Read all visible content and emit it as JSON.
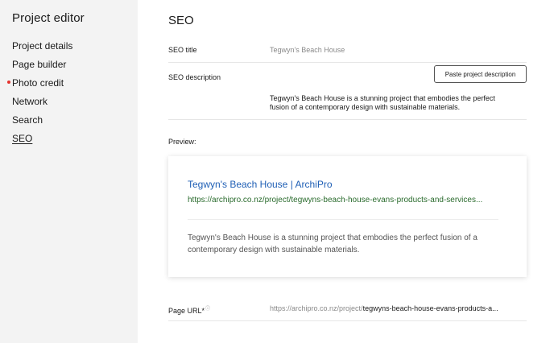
{
  "sidebar": {
    "title": "Project editor",
    "items": [
      {
        "label": "Project details"
      },
      {
        "label": "Page builder"
      },
      {
        "label": "Photo credit"
      },
      {
        "label": "Network"
      },
      {
        "label": "Search"
      },
      {
        "label": "SEO"
      }
    ]
  },
  "main": {
    "title": "SEO",
    "seo_title": {
      "label": "SEO title",
      "value": "Tegwyn's Beach House"
    },
    "seo_description": {
      "label": "SEO description",
      "button_label": "Paste project description",
      "value": "Tegwyn's Beach House is a stunning project that embodies the perfect fusion of a contemporary design with sustainable materials."
    },
    "preview": {
      "label": "Preview:",
      "title": "Tegwyn's Beach House | ArchiPro",
      "url": "https://archipro.co.nz/project/tegwyns-beach-house-evans-products-and-services...",
      "description": "Tegwyn's Beach House is a stunning project that embodies the perfect fusion of a contemporary design with sustainable materials."
    },
    "page_url": {
      "label": "Page URL*",
      "info_icon": "ⓘ",
      "prefix": "https://archipro.co.nz/project/",
      "slug": "tegwyns-beach-house-evans-products-a..."
    }
  },
  "colors": {
    "sidebar_bg": "#f3f3f3",
    "link_blue": "#1f5fb5",
    "url_green": "#2a6b2d",
    "attention_dot": "#e5322d"
  }
}
